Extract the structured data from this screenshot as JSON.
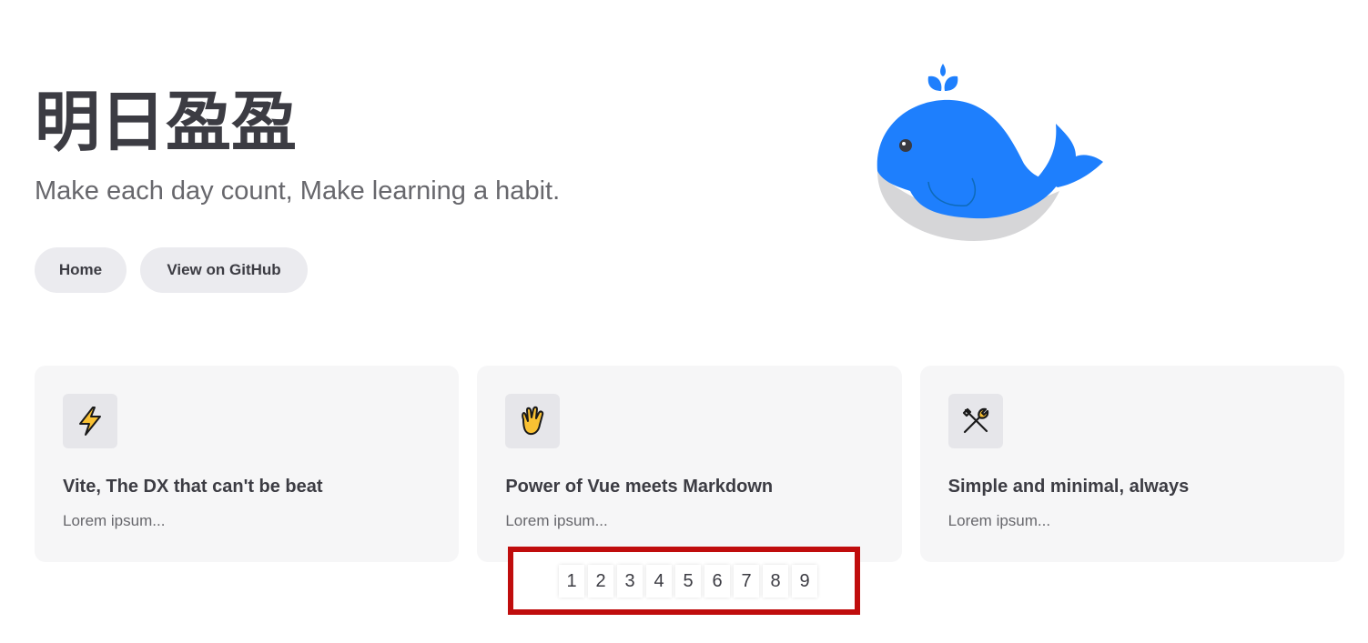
{
  "hero": {
    "name": "明日盈盈",
    "tagline": "Make each day count, Make learning a habit.",
    "actions": [
      {
        "label": "Home"
      },
      {
        "label": "View on GitHub"
      }
    ],
    "image": "whale-illustration"
  },
  "features": [
    {
      "icon": "lightning-icon",
      "title": "Vite, The DX that can't be beat",
      "details": "Lorem ipsum..."
    },
    {
      "icon": "vulcan-salute-icon",
      "title": "Power of Vue meets Markdown",
      "details": "Lorem ipsum..."
    },
    {
      "icon": "tools-icon",
      "title": "Simple and minimal, always",
      "details": "Lorem ipsum..."
    }
  ],
  "pagination": {
    "pages": [
      "1",
      "2",
      "3",
      "4",
      "5",
      "6",
      "7",
      "8",
      "9"
    ]
  },
  "colors": {
    "brand_blue": "#1e7ffd",
    "highlight_red": "#c00d0d",
    "text": "#3c3c43",
    "muted": "#67676c"
  }
}
